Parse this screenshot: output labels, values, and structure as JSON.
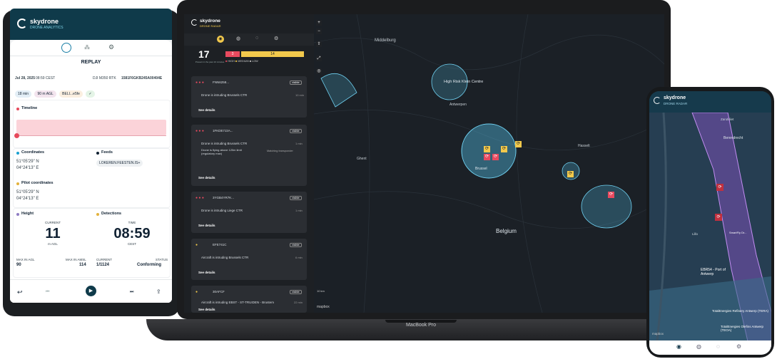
{
  "tablet": {
    "brand": "skydrone",
    "product": "DRONE ANALYTICS",
    "section_title": "REPLAY",
    "flight": {
      "date": "Jul 28, 2025",
      "time": "08:59 CEST",
      "model": "DJI M350 RTK",
      "serial": "1581F6GKB245A00404E"
    },
    "chips": [
      "18 min",
      "90 m AGL",
      "BELI...e5fe"
    ],
    "timeline_label": "Timeline",
    "coordinates": {
      "label": "Coordinates",
      "lat": "51°05'29\" N",
      "lon": "04°24'13\" E"
    },
    "feeds": {
      "label": "Feeds",
      "value": "LOKEREN.FEESTEN.IS+"
    },
    "pilot": {
      "label": "Pilot coordinates",
      "lat": "51°05'29\" N",
      "lon": "04°24'13\" E"
    },
    "height": {
      "label": "Height",
      "sub": "CURRENT",
      "value": "11",
      "unit": "m AGL",
      "max_agl_label": "MAX IN AGL",
      "max_agl": "90",
      "max_amsl_label": "MAX IN AMSL",
      "max_amsl": "114"
    },
    "detections": {
      "label": "Detections",
      "sub": "TIME",
      "value": "08:59",
      "unit": "CEST",
      "current_label": "CURRENT",
      "current": "1/1124",
      "status_label": "STATUS",
      "status": "Conforming"
    }
  },
  "laptop": {
    "brand": "skydrone",
    "product": "DRONE RADAR",
    "count": "17",
    "count_caption": "Present in the past 10 minutes",
    "severity": {
      "high": "3",
      "medium": "14",
      "high_label": "HIGH",
      "medium_label": "MEDIUM",
      "low_label": "LOW"
    },
    "see_details": "See details",
    "visible": "visible",
    "alerts": [
      {
        "id": "FNN6258...",
        "time": "10 min",
        "lines": [
          "Drone is intruding Brussels CTR"
        ]
      },
      {
        "id": "1FKDE7J2A...",
        "time": "1 min",
        "lines": [
          "Drone is intruding Brussels CTR",
          "Drone is flying above 120m limit (regulatory max)"
        ],
        "extra": "Matching transponder"
      },
      {
        "id": "3YGB4YR7K...",
        "time": "1 min",
        "lines": [
          "Drone is intruding Liege CTR"
        ]
      },
      {
        "id": "EFE741C",
        "time": "6 min",
        "lines": [
          "Aircraft is intruding Brussels CTR"
        ]
      },
      {
        "id": "30AFCF",
        "time": "22 min",
        "lines": [
          "Aircraft is intruding EBST - ST-TRUIDEN - Brustem"
        ]
      }
    ],
    "map_labels": [
      "Middelburg",
      "High Risk Klein Centre",
      "Antwerpen",
      "Ghent",
      "Hasselt",
      "Belgium",
      "Brussel"
    ],
    "scale": "10 km",
    "attribution": "mapbox",
    "model": "MacBook Pro"
  },
  "phone": {
    "brand": "skydrone",
    "product": "DRONE RADAR",
    "labels": [
      "Zandvliet",
      "Berendrecht",
      "Lillo",
      "EBR54 - Port of Antwerp",
      "TotalEnergies Refinery Antwerp (TERA)",
      "TotalEnergies Olefins Antwerp (TEOA)",
      "SmartFly Dr..."
    ],
    "attribution": "mapbox"
  }
}
